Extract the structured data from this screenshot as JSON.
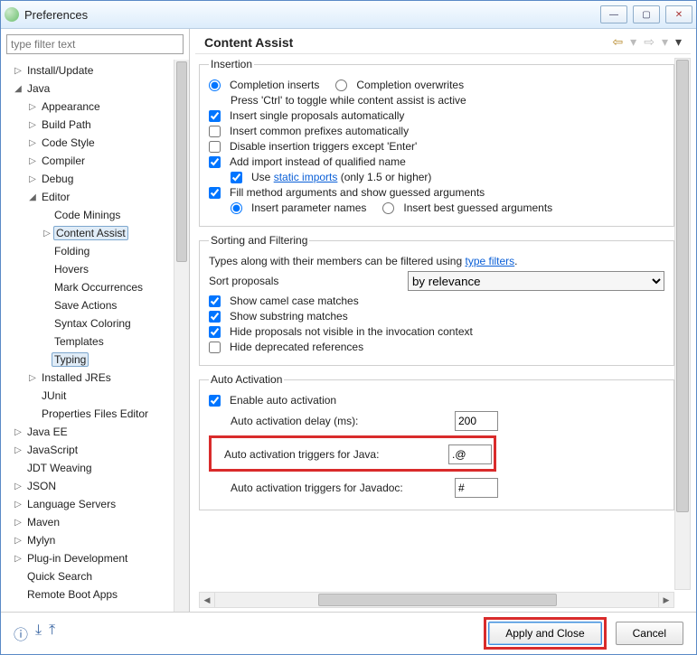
{
  "window": {
    "title": "Preferences"
  },
  "filter": {
    "placeholder": "type filter text"
  },
  "tree": {
    "install_update": "Install/Update",
    "java": "Java",
    "appearance": "Appearance",
    "build_path": "Build Path",
    "code_style": "Code Style",
    "compiler": "Compiler",
    "debug": "Debug",
    "editor": "Editor",
    "code_minings": "Code Minings",
    "content_assist": "Content Assist",
    "folding": "Folding",
    "hovers": "Hovers",
    "mark_occurrences": "Mark Occurrences",
    "save_actions": "Save Actions",
    "syntax_coloring": "Syntax Coloring",
    "templates": "Templates",
    "typing": "Typing",
    "installed_jres": "Installed JREs",
    "junit": "JUnit",
    "properties_files_editor": "Properties Files Editor",
    "java_ee": "Java EE",
    "javascript": "JavaScript",
    "jdt_weaving": "JDT Weaving",
    "json": "JSON",
    "language_servers": "Language Servers",
    "maven": "Maven",
    "mylyn": "Mylyn",
    "plugin_dev": "Plug-in Development",
    "quick_search": "Quick Search",
    "remote_boot_apps": "Remote Boot Apps"
  },
  "page": {
    "title": "Content Assist",
    "insertion": {
      "legend": "Insertion",
      "completion_inserts": "Completion inserts",
      "completion_overwrites": "Completion overwrites",
      "ctrl_note": "Press 'Ctrl' to toggle while content assist is active",
      "insert_single": "Insert single proposals automatically",
      "insert_common": "Insert common prefixes automatically",
      "disable_triggers": "Disable insertion triggers except 'Enter'",
      "add_import": "Add import instead of qualified name",
      "use_pre": "Use ",
      "static_imports": "static imports",
      "use_post": " (only 1.5 or higher)",
      "fill_method_args": "Fill method arguments and show guessed arguments",
      "insert_param_names": "Insert parameter names",
      "insert_best_guess": "Insert best guessed arguments"
    },
    "sorting": {
      "legend": "Sorting and Filtering",
      "note_pre": "Types along with their members can be filtered using ",
      "type_filters": "type filters",
      "note_post": ".",
      "sort_proposals": "Sort proposals",
      "by_relevance": "by relevance",
      "camel": "Show camel case matches",
      "substring": "Show substring matches",
      "hide_not_visible": "Hide proposals not visible in the invocation context",
      "hide_deprecated": "Hide deprecated references"
    },
    "auto": {
      "legend": "Auto Activation",
      "enable": "Enable auto activation",
      "delay_label": "Auto activation delay (ms):",
      "delay_value": "200",
      "triggers_java_label": "Auto activation triggers for Java:",
      "triggers_java_value": ".@",
      "triggers_javadoc_label": "Auto activation triggers for Javadoc:",
      "triggers_javadoc_value": "#"
    }
  },
  "footer": {
    "apply_close": "Apply and Close",
    "cancel": "Cancel"
  }
}
